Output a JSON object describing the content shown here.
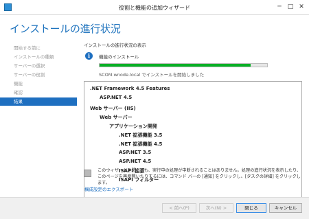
{
  "window": {
    "title": "役割と機能の追加ウィザード",
    "minimize": "─",
    "maximize": "□",
    "close": "✕"
  },
  "header": {
    "heading": "インストールの進行状況"
  },
  "sidebar": {
    "items": [
      {
        "label": "開始する前に"
      },
      {
        "label": "インストールの種類"
      },
      {
        "label": "サーバーの選択"
      },
      {
        "label": "サーバーの役割"
      },
      {
        "label": "機能"
      },
      {
        "label": "確認"
      },
      {
        "label": "結果"
      }
    ]
  },
  "main": {
    "section_label": "インストールの進行状況の表示",
    "info_icon": "i",
    "install_title": "機能のインストール",
    "progress": 0.9,
    "status_text": "SCOM.wnode.local でインストールを開始しました",
    "features": [
      {
        "label": ".NET Framework 4.5 Features",
        "level": 0
      },
      {
        "label": "ASP.NET 4.5",
        "level": 1
      },
      {
        "label": "Web サーバー (IIS)",
        "level": 0
      },
      {
        "label": "Web サーバー",
        "level": 1
      },
      {
        "label": "アプリケーション開発",
        "level": 2
      },
      {
        "label": ".NET 拡張機能 3.5",
        "level": 3
      },
      {
        "label": ".NET 拡張機能 4.5",
        "level": 3
      },
      {
        "label": "ASP.NET 3.5",
        "level": 3
      },
      {
        "label": "ASP.NET 4.5",
        "level": 3
      },
      {
        "label": "ISAPI 拡張",
        "level": 3
      },
      {
        "label": "ISAPI フィルター",
        "level": 3
      }
    ]
  },
  "notice": {
    "text": "このウィザードを閉じても、実行中の処理が中断されることはありません。処理の進行状況を表示したり、このページを再度開いたりするには、コマンド バーの [通知] をクリックし、[タスクの詳細] をクリックします。"
  },
  "export_link": "構成設定のエクスポート",
  "footer": {
    "prev": "< 前へ(P)",
    "next": "次へ(N) >",
    "close": "閉じる",
    "cancel": "キャンセル"
  }
}
